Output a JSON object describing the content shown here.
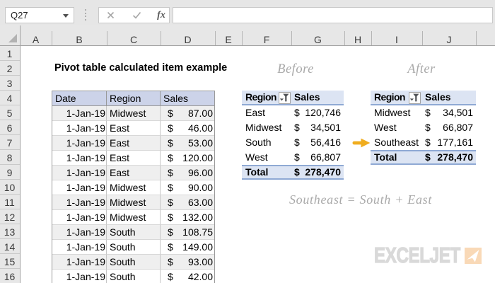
{
  "window": {
    "app": "Excel worksheet"
  },
  "colors": {
    "chrome_bg": "#e6e6e6",
    "header_strip_bg": "#e7e7e7",
    "table_header_fill": "#ccd3e9",
    "pivot_fill": "#dce4f3",
    "pivot_border_blue": "#8fa9d4",
    "band_fill": "#efefef",
    "arrow_orange": "#f0ad1f",
    "annotation_gray": "#a9a9a9",
    "logo_gray": "#d9d9d9",
    "logo_box_orange": "#f9d9b7"
  },
  "chrome": {
    "name_box_value": "Q27",
    "cancel_icon": "cancel",
    "enter_icon": "enter",
    "insert_function_label": "fx",
    "formula_value": ""
  },
  "grid": {
    "columns": [
      "A",
      "B",
      "C",
      "D",
      "E",
      "F",
      "G",
      "H",
      "I",
      "J"
    ],
    "rows": [
      "1",
      "2",
      "3",
      "4",
      "5",
      "6",
      "7",
      "8",
      "9",
      "10",
      "11",
      "12",
      "13",
      "14",
      "15",
      "16"
    ]
  },
  "sheet": {
    "title": "Pivot table calculated item example",
    "before_label": "Before",
    "after_label": "After",
    "annotation": "Southeast = South + East",
    "logo_text": "EXCELJET"
  },
  "data_table": {
    "headers": {
      "date": "Date",
      "region": "Region",
      "sales": "Sales"
    },
    "rows": [
      {
        "date": "1-Jan-19",
        "region": "Midwest",
        "currency": "$",
        "amount": "87.00"
      },
      {
        "date": "1-Jan-19",
        "region": "East",
        "currency": "$",
        "amount": "46.00"
      },
      {
        "date": "1-Jan-19",
        "region": "East",
        "currency": "$",
        "amount": "53.00"
      },
      {
        "date": "1-Jan-19",
        "region": "East",
        "currency": "$",
        "amount": "120.00"
      },
      {
        "date": "1-Jan-19",
        "region": "East",
        "currency": "$",
        "amount": "96.00"
      },
      {
        "date": "1-Jan-19",
        "region": "Midwest",
        "currency": "$",
        "amount": "90.00"
      },
      {
        "date": "1-Jan-19",
        "region": "Midwest",
        "currency": "$",
        "amount": "63.00"
      },
      {
        "date": "1-Jan-19",
        "region": "Midwest",
        "currency": "$",
        "amount": "132.00"
      },
      {
        "date": "1-Jan-19",
        "region": "South",
        "currency": "$",
        "amount": "108.75"
      },
      {
        "date": "1-Jan-19",
        "region": "South",
        "currency": "$",
        "amount": "149.00"
      },
      {
        "date": "1-Jan-19",
        "region": "South",
        "currency": "$",
        "amount": "93.00"
      },
      {
        "date": "1-Jan-19",
        "region": "South",
        "currency": "$",
        "amount": "42.00"
      }
    ]
  },
  "pivot_before": {
    "region_header": "Region",
    "sales_header": "Sales",
    "rows": [
      {
        "region": "East",
        "currency": "$",
        "amount": "120,746"
      },
      {
        "region": "Midwest",
        "currency": "$",
        "amount": "34,501"
      },
      {
        "region": "South",
        "currency": "$",
        "amount": "56,416"
      },
      {
        "region": "West",
        "currency": "$",
        "amount": "66,807"
      }
    ],
    "total": {
      "label": "Total",
      "currency": "$",
      "amount": "278,470"
    }
  },
  "pivot_after": {
    "region_header": "Region",
    "sales_header": "Sales",
    "rows": [
      {
        "region": "Midwest",
        "currency": "$",
        "amount": "34,501"
      },
      {
        "region": "West",
        "currency": "$",
        "amount": "66,807"
      },
      {
        "region": "Southeast",
        "currency": "$",
        "amount": "177,161"
      }
    ],
    "total": {
      "label": "Total",
      "currency": "$",
      "amount": "278,470"
    }
  }
}
